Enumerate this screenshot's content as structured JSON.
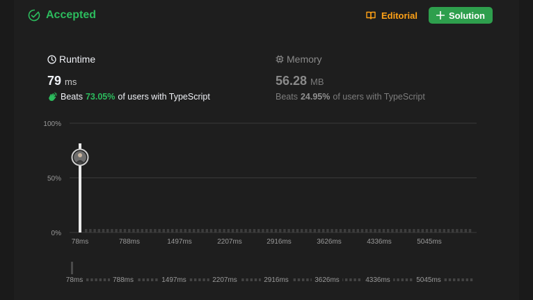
{
  "header": {
    "status": "Accepted",
    "editorial_label": "Editorial",
    "solution_label": "Solution",
    "status_color": "#2cbb5d",
    "editorial_color": "#ffa116",
    "solution_bg": "#2e9f4d"
  },
  "runtime": {
    "title": "Runtime",
    "value": "79",
    "unit": "ms",
    "beats_prefix": "Beats",
    "beats_pct": "73.05%",
    "beats_suffix": "of users with TypeScript",
    "icon": "clock-icon",
    "beats_icon": "clapping-hands-icon"
  },
  "memory": {
    "title": "Memory",
    "value": "56.28",
    "unit": "MB",
    "beats_prefix": "Beats",
    "beats_pct": "24.95%",
    "beats_suffix": "of users with TypeScript",
    "icon": "chip-icon"
  },
  "chart_data": {
    "type": "bar",
    "title": "",
    "xlabel": "",
    "ylabel": "",
    "y_ticks": [
      "100%",
      "50%",
      "0%"
    ],
    "ylim": [
      0,
      100
    ],
    "x_ticks": [
      "78ms",
      "788ms",
      "1497ms",
      "2207ms",
      "2916ms",
      "3626ms",
      "4336ms",
      "5045ms"
    ],
    "highlight": {
      "x": "79ms",
      "percentile": 73.05,
      "marker": "user-avatar"
    },
    "minimap_ticks": [
      "78ms",
      "788ms",
      "1497ms",
      "2207ms",
      "2916ms",
      "3626ms",
      "4336ms",
      "5045ms"
    ],
    "grid": true
  }
}
